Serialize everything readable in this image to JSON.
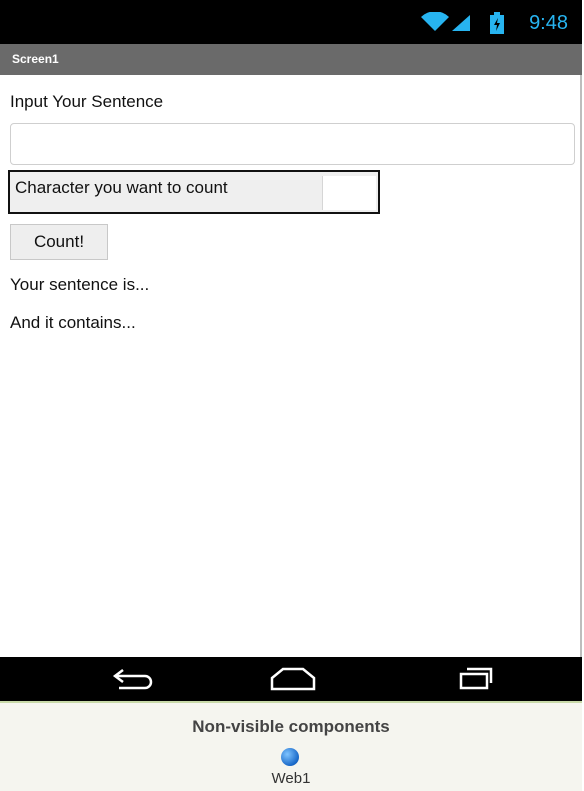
{
  "status_bar": {
    "time": "9:48",
    "icons": [
      "wifi-icon",
      "signal-icon",
      "battery-icon"
    ],
    "accent_color": "#27b4f0"
  },
  "screen": {
    "title": "Screen1"
  },
  "form": {
    "sentence_label": "Input Your Sentence",
    "sentence_value": "",
    "char_label": "Character you want to count",
    "char_value": "",
    "count_button": "Count!",
    "result_sentence": "Your sentence is...",
    "result_contains": "And it contains..."
  },
  "nav_bar": {
    "icons": [
      "back-icon",
      "home-icon",
      "recent-apps-icon"
    ]
  },
  "non_visible": {
    "title": "Non-visible components",
    "components": [
      {
        "name": "Web1",
        "icon": "globe-icon"
      }
    ]
  }
}
